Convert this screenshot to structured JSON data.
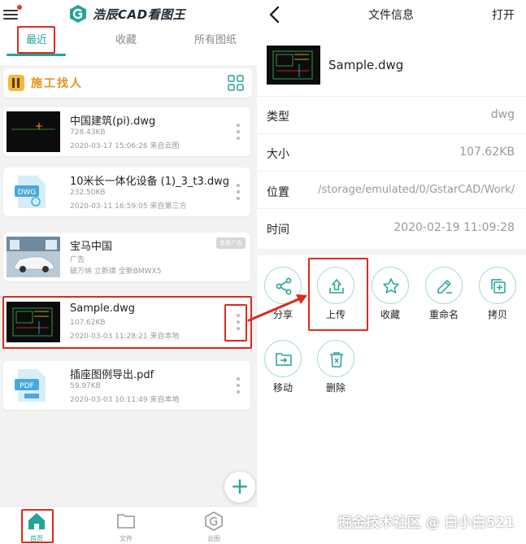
{
  "left": {
    "app_title": "浩辰CAD看图王",
    "tabs": [
      {
        "label": "最近",
        "active": true
      },
      {
        "label": "收藏",
        "active": false
      },
      {
        "label": "所有图纸",
        "active": false
      }
    ],
    "banner": {
      "text": "施工找人"
    },
    "files": [
      {
        "name": "中国建筑(pi).dwg",
        "size": "728.43KB",
        "meta": "2020-03-17 15:06:26  来自云图",
        "thumb": "cad-dark"
      },
      {
        "name": "10米长一体化设备 (1)_3_t3.dwg",
        "size": "232.50KB",
        "meta": "2020-03-11 16:59:05  来自第三方",
        "thumb": "dwg-badge",
        "badge_text": "DWG"
      },
      {
        "name": "宝马中国",
        "size": "广告",
        "meta": "破万纳 立新境 全新BMWX5",
        "thumb": "car",
        "ad_tag": "查看广告"
      },
      {
        "name": "Sample.dwg",
        "size": "107.62KB",
        "meta": "2020-03-03 11:28:21  来自本地",
        "thumb": "cad-dark"
      },
      {
        "name": "插座图例导出.pdf",
        "size": "59.97KB",
        "meta": "2020-03-03 10:11:49  来自本地",
        "thumb": "pdf-badge",
        "badge_text": "PDF"
      }
    ],
    "fab": "+",
    "nav": [
      {
        "label": "首页",
        "icon": "home-icon",
        "active": true
      },
      {
        "label": "文件",
        "icon": "folder-icon",
        "active": false
      },
      {
        "label": "云图",
        "icon": "cloud-logo-icon",
        "active": false
      }
    ]
  },
  "right": {
    "title": "文件信息",
    "open_label": "打开",
    "file_name": "Sample.dwg",
    "info": [
      {
        "label": "类型",
        "value": "dwg"
      },
      {
        "label": "大小",
        "value": "107.62KB"
      },
      {
        "label": "位置",
        "value": "/storage/emulated/0/GstarCAD/Work/"
      },
      {
        "label": "时间",
        "value": "2020-02-19 11:09:28"
      }
    ],
    "actions": [
      {
        "label": "分享",
        "icon": "share-icon"
      },
      {
        "label": "上传",
        "icon": "upload-icon"
      },
      {
        "label": "收藏",
        "icon": "star-icon"
      },
      {
        "label": "重命名",
        "icon": "rename-icon"
      },
      {
        "label": "拷贝",
        "icon": "copy-icon"
      },
      {
        "label": "移动",
        "icon": "move-icon"
      },
      {
        "label": "删除",
        "icon": "delete-icon"
      }
    ]
  },
  "watermark": "掘金技术社区 @ 白小白521",
  "colors": {
    "accent": "#23a39a",
    "highlight": "#e0281c",
    "banner_text": "#e0921c"
  }
}
